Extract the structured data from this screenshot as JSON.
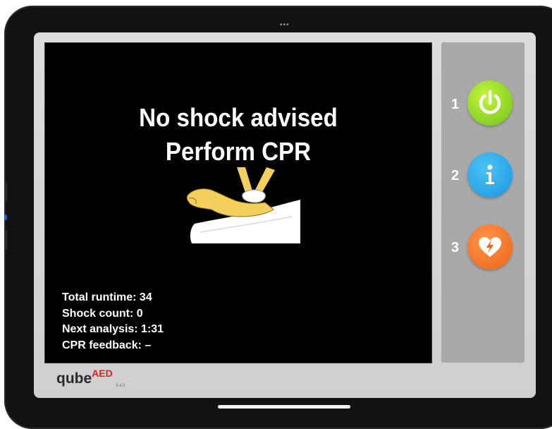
{
  "screen": {
    "headline_line1": "No shock advised",
    "headline_line2": "Perform CPR",
    "illustration_icon": "cpr-chest-compression-illustration"
  },
  "stats": {
    "total_runtime": "Total runtime: 34",
    "shock_count": "Shock count: 0",
    "next_analysis": "Next analysis: 1:31",
    "cpr_feedback": "CPR feedback: –"
  },
  "side_panel": {
    "buttons": [
      {
        "number": "1",
        "icon": "power-icon",
        "color": "#7ed321"
      },
      {
        "number": "2",
        "icon": "info-icon",
        "color": "#22a7ea"
      },
      {
        "number": "3",
        "icon": "heart-shock-icon",
        "color": "#f26d21"
      }
    ]
  },
  "brand": {
    "name": "qube",
    "suffix": "AED",
    "version": "3.4.0",
    "accent_color": "#e41e26"
  }
}
